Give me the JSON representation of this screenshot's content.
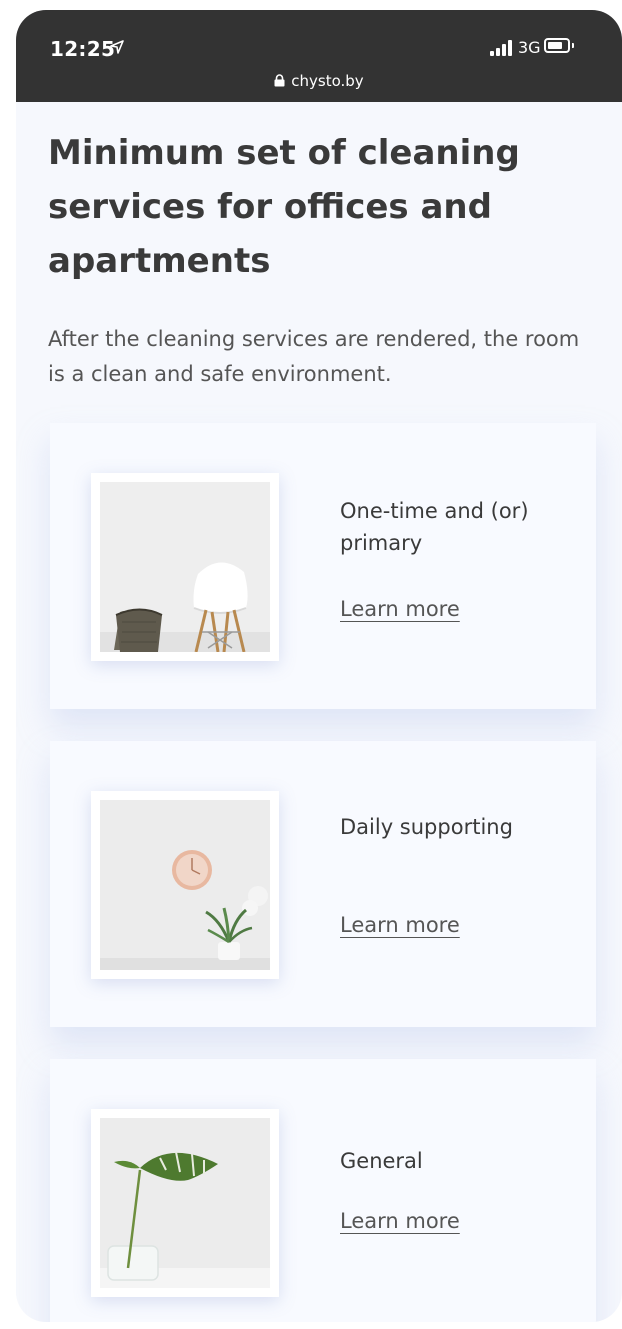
{
  "status": {
    "time": "12:25",
    "network": "3G",
    "url": "chysto.by",
    "icons": [
      "location-arrow-icon",
      "signal-icon",
      "battery-icon",
      "lock-icon"
    ]
  },
  "main": {
    "title": "Minimum set of cleaning services for offices and apartments",
    "subtitle": "After the cleaning services are rendered, the room is a clean and safe environment."
  },
  "cards": [
    {
      "title": "One-time and (or) primary",
      "link": "Learn more"
    },
    {
      "title": "Daily supporting",
      "link": "Learn more"
    },
    {
      "title": "General",
      "link": "Learn more"
    }
  ],
  "colors": {
    "status_bar": "#333333",
    "background": "#f6f8fd",
    "card": "#f8faff",
    "text": "#3a3a3a"
  }
}
